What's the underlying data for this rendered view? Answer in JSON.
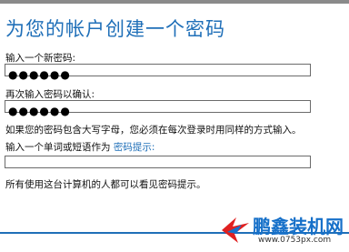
{
  "title": "为您的帐户创建一个密码",
  "new_password": {
    "label": "输入一个新密码:",
    "value": "●●●●●●"
  },
  "confirm_password": {
    "label": "再次输入密码以确认:",
    "value": "●●●●●●"
  },
  "case_hint": "如果您的密码包含大写字母，您必须在每次登录时用同样的方式输入。",
  "hint_prompt": {
    "prefix": "输入一个单词或短语作为",
    "link": "密码提示:"
  },
  "hint_input": {
    "value": ""
  },
  "visibility_note": "所有使用这台计算机的人都可以看见密码提示。",
  "watermark": {
    "name": "鹏鑫装机网",
    "url": "www.0753px.com"
  },
  "colors": {
    "title": "#1f6fb8",
    "link": "#1f6fb8",
    "watermark": "#1670c9",
    "logo_red": "#e02020"
  }
}
